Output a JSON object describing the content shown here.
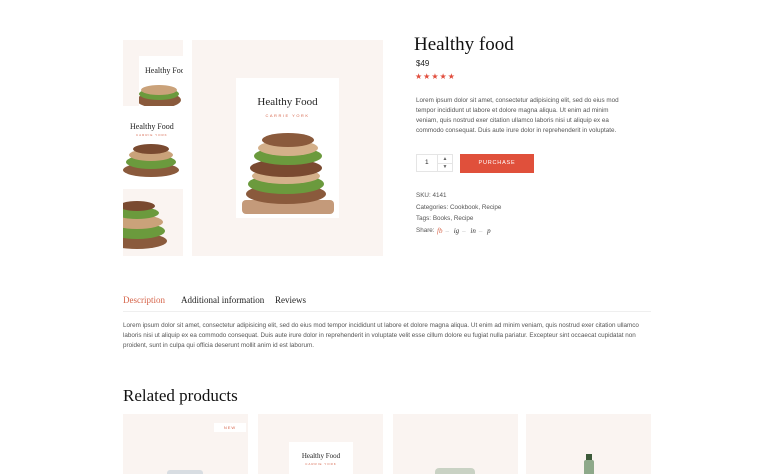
{
  "product": {
    "title": "Healthy food",
    "price": "$49",
    "stars": "★★★★★",
    "description": "Lorem ipsum dolor sit amet, consectetur adipisicing elit, sed do eius mod tempor incididunt ut labore et dolore magna aliqua. Ut enim ad minim veniam, quis nostrud exer citation ullamco laboris nisi ut aliquip ex ea commodo consequat. Duis aute irure dolor in reprehenderit in voluptate.",
    "quantity": "1",
    "purchase_label": "PURCHASE",
    "sku_label": "SKU:",
    "sku": "4141",
    "categories_label": "Categories:",
    "categories": [
      "Cookbook",
      "Recipe"
    ],
    "tags_label": "Tags:",
    "tags": [
      "Books",
      "Recipe"
    ],
    "share_label": "Share:",
    "share_icons": [
      "fb",
      "ig",
      "in",
      "p"
    ]
  },
  "book_cover": {
    "title": "Healthy Food",
    "author": "CARRIE YORK"
  },
  "tabs": [
    "Description",
    "Additional information",
    "Reviews"
  ],
  "tab_content": "Lorem ipsum dolor sit amet, consectetur adipisicing elit, sed do eius mod tempor incididunt ut labore et dolore magna aliqua. Ut enim ad minim veniam, quis nostrud exer citation ullamco laboris nisi ut aliquip ex ea commodo consequat. Duis aute irure dolor in reprehenderit in voluptate velit esse cillum dolore eu fugiat nulla pariatur. Excepteur sint occaecat cupidatat non proident, sunt in culpa qui officia deserunt mollit anim id est laborum.",
  "related": {
    "heading": "Related products",
    "badge": "NEW"
  },
  "colors": {
    "accent": "#e0503b",
    "image_bg": "#faf4f1"
  }
}
